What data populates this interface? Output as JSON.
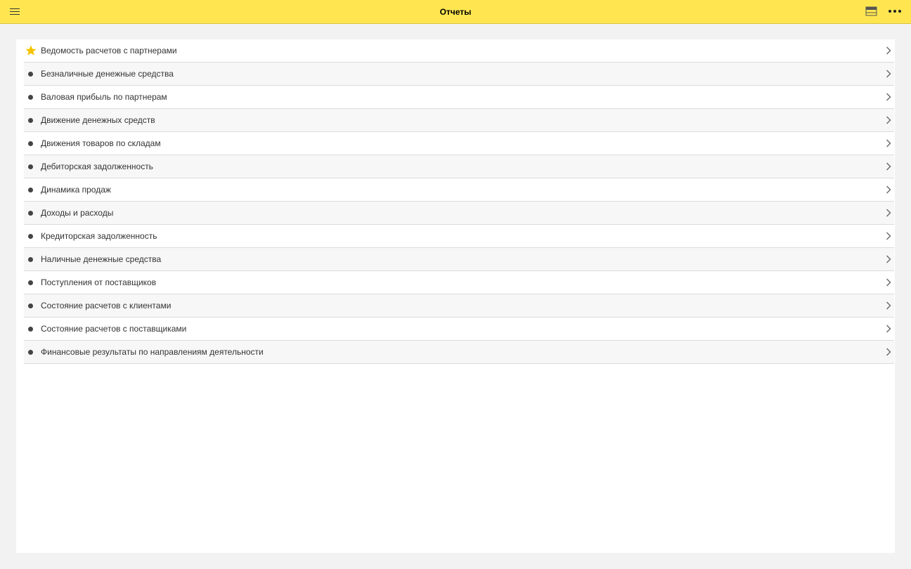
{
  "header": {
    "title": "Отчеты",
    "menu_icon": "hamburger-menu-icon",
    "panel_icon": "panel-toggle-icon",
    "more_icon": "more-horizontal-icon",
    "accent_color": "#ffe650"
  },
  "reports": {
    "items": [
      {
        "label": "Ведомость расчетов с партнерами",
        "favorite": true
      },
      {
        "label": "Безналичные денежные средства",
        "favorite": false
      },
      {
        "label": "Валовая прибыль по партнерам",
        "favorite": false
      },
      {
        "label": "Движение денежных средств",
        "favorite": false
      },
      {
        "label": "Движения товаров по складам",
        "favorite": false
      },
      {
        "label": "Дебиторская задолженность",
        "favorite": false
      },
      {
        "label": "Динамика продаж",
        "favorite": false
      },
      {
        "label": "Доходы и расходы",
        "favorite": false
      },
      {
        "label": "Кредиторская задолженность",
        "favorite": false
      },
      {
        "label": "Наличные денежные средства",
        "favorite": false
      },
      {
        "label": "Поступления от поставщиков",
        "favorite": false
      },
      {
        "label": "Состояние расчетов с клиентами",
        "favorite": false
      },
      {
        "label": "Состояние расчетов с поставщиками",
        "favorite": false
      },
      {
        "label": "Финансовые результаты по направлениям деятельности",
        "favorite": false
      }
    ],
    "star_color": "#f5c400"
  }
}
